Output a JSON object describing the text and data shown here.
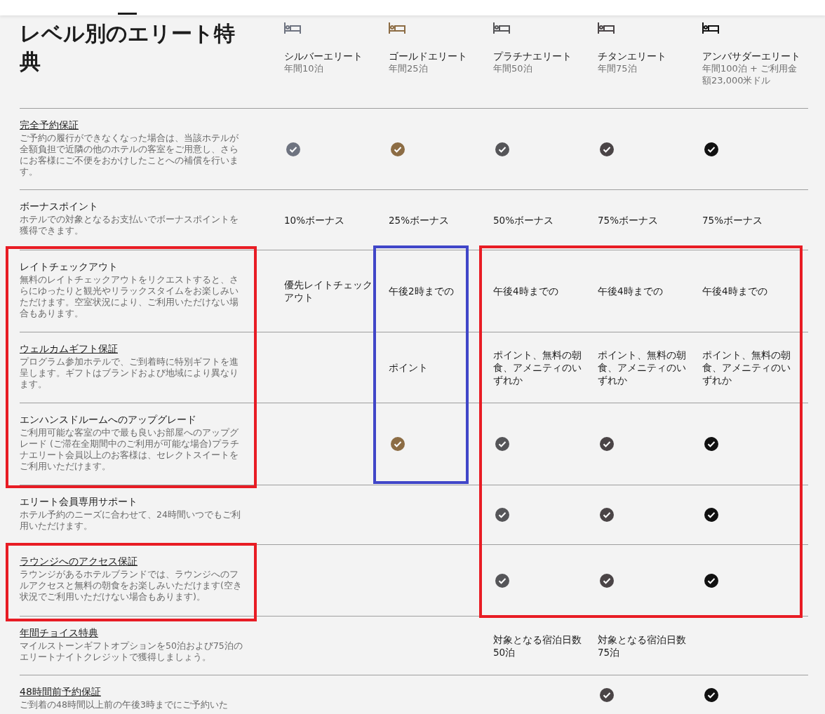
{
  "title": "レベル別のエリート特典",
  "tiers": [
    {
      "name": "シルバーエリート",
      "requirement": "年間10泊",
      "color": "#6e7380"
    },
    {
      "name": "ゴールドエリート",
      "requirement": "年間25泊",
      "color": "#8c6c44"
    },
    {
      "name": "プラチナエリート",
      "requirement": "年間50泊",
      "color": "#555558"
    },
    {
      "name": "チタンエリート",
      "requirement": "年間75泊",
      "color": "#4a4446"
    },
    {
      "name": "アンバサダーエリート",
      "requirement": "年間100泊 + ご利用金額23,000米ドル",
      "color": "#111111"
    }
  ],
  "benefits": [
    {
      "title": "完全予約保証",
      "link": true,
      "description": "ご予約の履行ができなくなった場合は、当該ホテルが全額負担で近隣の他のホテルの客室をご用意し、さらにお客様にご不便をおかけしたことへの補償を行います。",
      "cells": [
        {
          "kind": "check"
        },
        {
          "kind": "check"
        },
        {
          "kind": "check"
        },
        {
          "kind": "check"
        },
        {
          "kind": "check"
        }
      ]
    },
    {
      "title": "ボーナスポイント",
      "link": false,
      "description": "ホテルでの対象となるお支払いでボーナスポイントを獲得できます。",
      "cells": [
        {
          "kind": "text",
          "text": "10%ボーナス"
        },
        {
          "kind": "text",
          "text": "25%ボーナス"
        },
        {
          "kind": "text",
          "text": "50%ボーナス"
        },
        {
          "kind": "text",
          "text": "75%ボーナス"
        },
        {
          "kind": "text",
          "text": "75%ボーナス"
        }
      ]
    },
    {
      "title": "レイトチェックアウト",
      "link": false,
      "description": "無料のレイトチェックアウトをリクエストすると、さらにゆったりと観光やリラックスタイムをお楽しみいただけます。空室状況により、ご利用いただけない場合もあります。",
      "cells": [
        {
          "kind": "text",
          "text": "優先レイトチェックアウト"
        },
        {
          "kind": "text",
          "text": "午後2時までの"
        },
        {
          "kind": "text",
          "text": "午後4時までの"
        },
        {
          "kind": "text",
          "text": "午後4時までの"
        },
        {
          "kind": "text",
          "text": "午後4時までの"
        }
      ]
    },
    {
      "title": "ウェルカムギフト保証",
      "link": true,
      "description": "プログラム参加ホテルで、ご到着時に特別ギフトを進呈します。ギフトはブランドおよび地域により異なります。",
      "cells": [
        {
          "kind": "blank"
        },
        {
          "kind": "text",
          "text": "ポイント"
        },
        {
          "kind": "text",
          "text": "ポイント、無料の朝食、アメニティのいずれか"
        },
        {
          "kind": "text",
          "text": "ポイント、無料の朝食、アメニティのいずれか"
        },
        {
          "kind": "text",
          "text": "ポイント、無料の朝食、アメニティのいずれか"
        }
      ]
    },
    {
      "title": "エンハンスドルームへのアップグレード",
      "link": false,
      "description": "ご利用可能な客室の中で最も良いお部屋へのアップグレード (ご滞在全期間中のご利用が可能な場合)プラチナエリート会員以上のお客様は、セレクトスイートをご利用いただけます。",
      "cells": [
        {
          "kind": "blank"
        },
        {
          "kind": "check"
        },
        {
          "kind": "check"
        },
        {
          "kind": "check"
        },
        {
          "kind": "check"
        }
      ]
    },
    {
      "title": "エリート会員専用サポート",
      "link": false,
      "description": "ホテル予約のニーズに合わせて、24時間いつでもご利用いただけます。",
      "cells": [
        {
          "kind": "blank"
        },
        {
          "kind": "blank"
        },
        {
          "kind": "check"
        },
        {
          "kind": "check"
        },
        {
          "kind": "check"
        }
      ]
    },
    {
      "title": "ラウンジへのアクセス保証",
      "link": true,
      "description": "ラウンジがあるホテルブランドでは、ラウンジへのフルアクセスと無料の朝食をお楽しみいただけます(空き状況でご利用いただけない場合もあります)。",
      "cells": [
        {
          "kind": "blank"
        },
        {
          "kind": "blank"
        },
        {
          "kind": "check"
        },
        {
          "kind": "check"
        },
        {
          "kind": "check"
        }
      ]
    },
    {
      "title": "年間チョイス特典",
      "link": true,
      "description": "マイルストーンギフトオプションを50泊および75泊のエリートナイトクレジットで獲得しましょう。",
      "cells": [
        {
          "kind": "blank"
        },
        {
          "kind": "blank"
        },
        {
          "kind": "text",
          "text": "対象となる宿泊日数50泊"
        },
        {
          "kind": "text",
          "text": "対象となる宿泊日数75泊"
        },
        {
          "kind": "blank"
        }
      ]
    },
    {
      "title": "48時間前予約保証",
      "link": true,
      "description": "ご到着の48時間以上前の午後3時までにご予約いた",
      "cells": [
        {
          "kind": "blank"
        },
        {
          "kind": "blank"
        },
        {
          "kind": "blank"
        },
        {
          "kind": "check"
        },
        {
          "kind": "check"
        }
      ]
    }
  ],
  "highlights": [
    {
      "color": "#e81c24"
    },
    {
      "color": "#4046c8"
    },
    {
      "color": "#e81c24"
    },
    {
      "color": "#e81c24"
    }
  ]
}
